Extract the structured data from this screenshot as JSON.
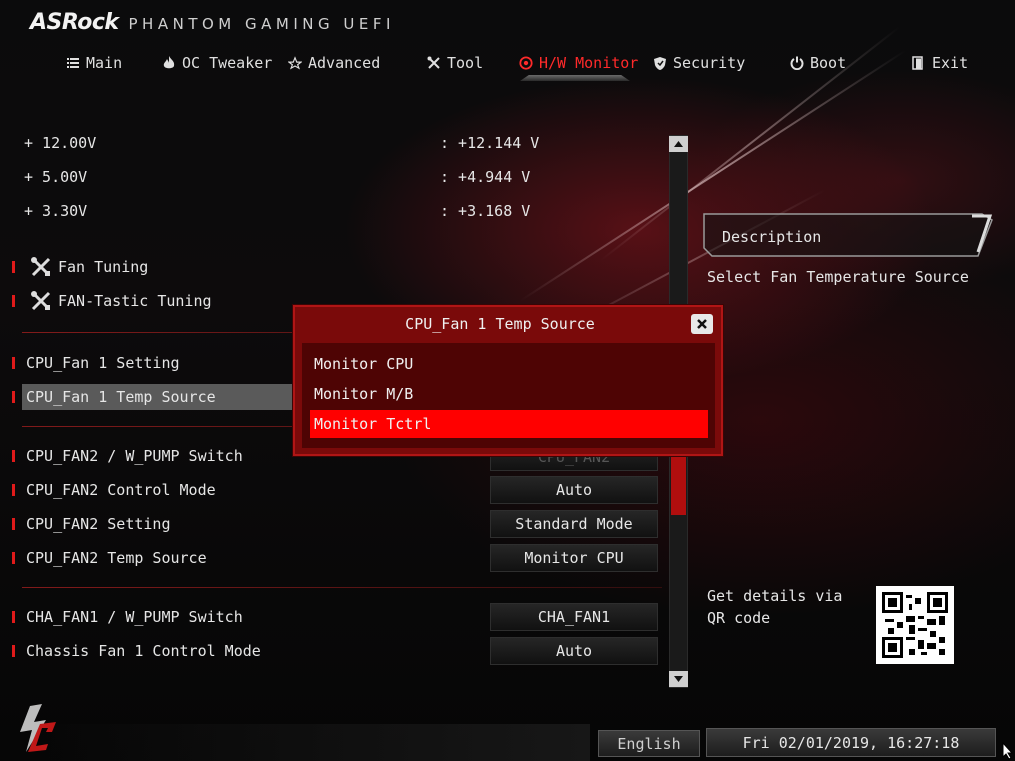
{
  "header": {
    "brand": "ASRock",
    "subtitle": "PHANTOM GAMING UEFI"
  },
  "nav": {
    "tabs": [
      {
        "label": "Main",
        "icon": "list-icon"
      },
      {
        "label": "OC Tweaker",
        "icon": "flame-icon"
      },
      {
        "label": "Advanced",
        "icon": "star-icon"
      },
      {
        "label": "Tool",
        "icon": "tools-icon"
      },
      {
        "label": "H/W Monitor",
        "icon": "monitor-icon",
        "active": true
      },
      {
        "label": "Security",
        "icon": "shield-icon"
      },
      {
        "label": "Boot",
        "icon": "power-icon"
      },
      {
        "label": "Exit",
        "icon": "exit-icon"
      }
    ]
  },
  "voltages": [
    {
      "label": "+ 12.00V",
      "value": ": +12.144 V"
    },
    {
      "label": "+ 5.00V",
      "value": ": +4.944 V"
    },
    {
      "label": "+ 3.30V",
      "value": ": +3.168 V"
    }
  ],
  "tools": [
    {
      "label": "Fan Tuning"
    },
    {
      "label": "FAN-Tastic Tuning"
    }
  ],
  "settings": {
    "cpu_fan1_setting": "CPU_Fan 1 Setting",
    "cpu_fan1_temp_source": "CPU_Fan 1 Temp Source",
    "cpu_fan2_switch": {
      "label": "CPU_FAN2 / W_PUMP Switch",
      "value": "CPU_FAN2"
    },
    "cpu_fan2_control": {
      "label": "CPU_FAN2 Control Mode",
      "value": "Auto"
    },
    "cpu_fan2_setting": {
      "label": "CPU_FAN2 Setting",
      "value": "Standard Mode"
    },
    "cpu_fan2_temp": {
      "label": "CPU_FAN2 Temp Source",
      "value": "Monitor CPU"
    },
    "cha_fan1_switch": {
      "label": "CHA_FAN1 / W_PUMP Switch",
      "value": "CHA_FAN1"
    },
    "chassis_fan1_control": {
      "label": "Chassis Fan 1 Control Mode",
      "value": "Auto"
    }
  },
  "description": {
    "title": "Description",
    "text": "Select Fan Temperature Source",
    "qr_text": "Get details via QR code"
  },
  "dialog": {
    "title": "CPU_Fan 1 Temp Source",
    "options": [
      "Monitor CPU",
      "Monitor M/B",
      "Monitor Tctrl"
    ],
    "selected": "Monitor Tctrl"
  },
  "footer": {
    "language": "English",
    "datetime": "Fri 02/01/2019, 16:27:18"
  },
  "colors": {
    "accent": "#ff0000",
    "dialog_bg": "#7a0a0a",
    "selection": "#5a5a5a"
  }
}
